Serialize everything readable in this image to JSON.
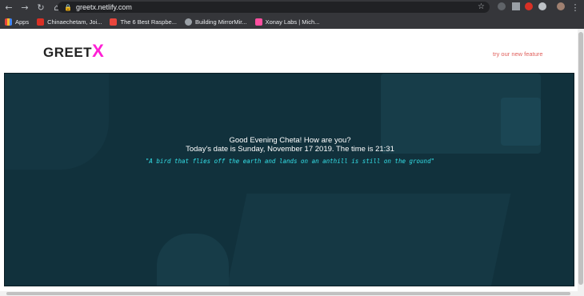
{
  "browser": {
    "url": "greetx.netlify.com",
    "bookmarks": [
      {
        "label": "Apps",
        "color": "#e8453c"
      },
      {
        "label": "Chinaechetam, Joi...",
        "color": "#d93025"
      },
      {
        "label": "The 6 Best Raspbe...",
        "color": "#e8453c"
      },
      {
        "label": "Building MirrorMir...",
        "color": "#9aa0a6"
      },
      {
        "label": "Xonay Labs | Mich...",
        "color": "#ff4fa0"
      }
    ]
  },
  "site": {
    "logo_text": "GREET",
    "logo_accent": "X",
    "feature_link": "try our new feature",
    "greeting_line1": "Good Evening Cheta! How are you?",
    "greeting_line2": "Today's date is Sunday, November 17 2019. The time is 21:31",
    "quote": "\"A bird that flies off the earth and lands on an anthill is still on the ground\""
  },
  "colors": {
    "accent": "#ff1fd5",
    "hero_bg": "#11313c",
    "quote": "#34e0e8",
    "link": "#e0605c"
  }
}
